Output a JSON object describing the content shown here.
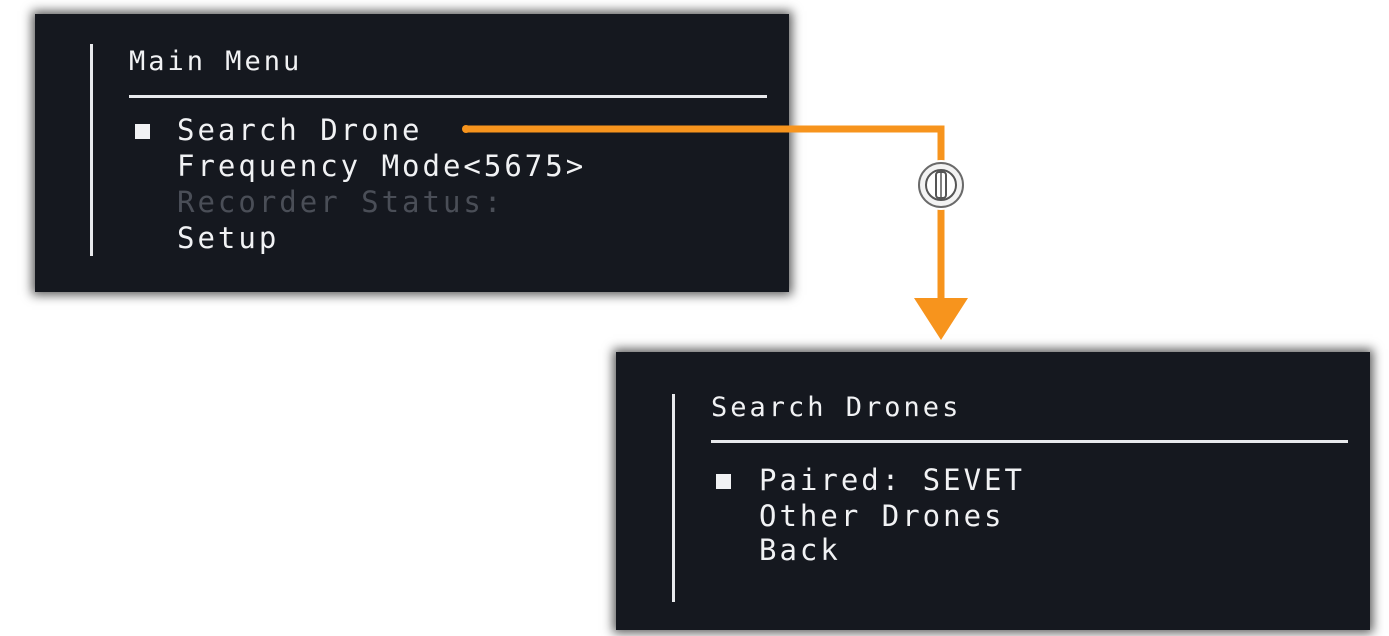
{
  "main_menu": {
    "title": "Main Menu",
    "items": [
      {
        "label": "Search Drone",
        "selected": true,
        "enabled": true
      },
      {
        "label": "Frequency Mode<5675>",
        "selected": false,
        "enabled": true
      },
      {
        "label": "Recorder Status:",
        "selected": false,
        "enabled": false
      },
      {
        "label": "Setup",
        "selected": false,
        "enabled": true
      }
    ]
  },
  "search_menu": {
    "title": "Search Drones",
    "items": [
      {
        "label": "Paired: SEVET",
        "selected": true,
        "enabled": true
      },
      {
        "label": "Other Drones",
        "selected": false,
        "enabled": true
      },
      {
        "label": "Back",
        "selected": false,
        "enabled": true
      }
    ]
  },
  "connector": {
    "color": "#f7941d",
    "control_icon": "knob-press-icon"
  },
  "colors": {
    "screen_background": "#15181f",
    "text": "#f1f2f4",
    "disabled_text": "#4a4e57"
  }
}
